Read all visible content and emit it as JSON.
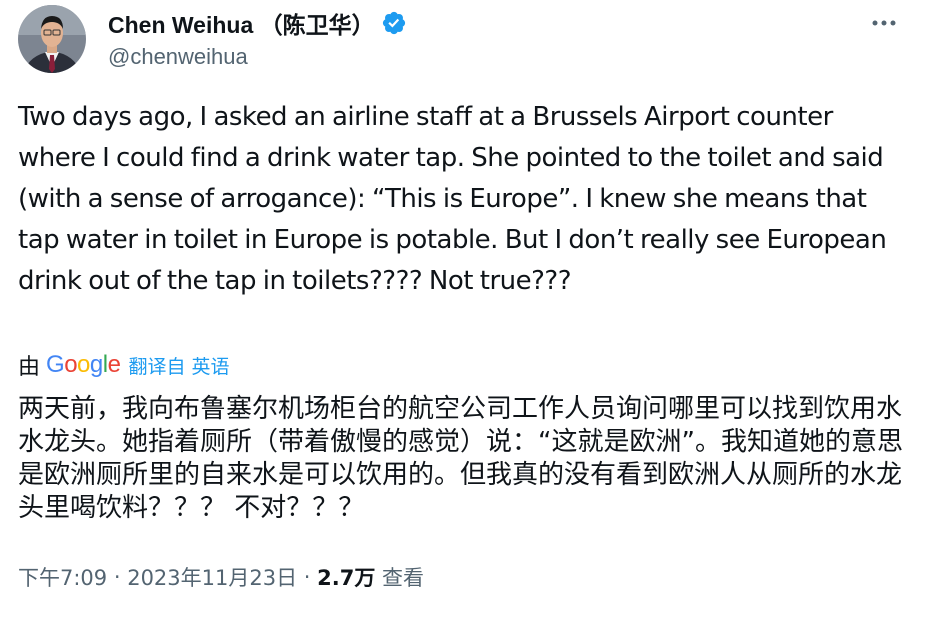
{
  "author": {
    "display_name": "Chen Weihua （陈卫华）",
    "handle": "@chenweihua",
    "verified": true,
    "avatar_icon": "profile-photo"
  },
  "more_icon": "more-horizontal-icon",
  "tweet": {
    "text_en": "Two days ago, I asked an airline staff at a Brussels Airport counter where I could find a drink water tap.  She pointed to the toilet and said (with a sense of arrogance): “This is Europe”. I knew she means that tap water in toilet in Europe is potable. But I don’t really see European drink out of the tap in toilets???? Not true???",
    "translation": {
      "by_label": "由",
      "provider": "Google",
      "from_label": "翻译自 英语"
    },
    "text_zh": "两天前，我向布鲁塞尔机场柜台的航空公司工作人员询问哪里可以找到饮用水水龙头。她指着厕所（带着傲慢的感觉）说：“这就是欧洲”。我知道她的意思是欧洲厕所里的自来水是可以饮用的。但我真的没有看到欧洲人从厕所的水龙头里喝饮料？？？ 不对？？？"
  },
  "meta": {
    "time": "下午7:09",
    "separator": " · ",
    "date": "2023年11月23日",
    "views_count": "2.7万",
    "views_label": " 查看"
  },
  "colors": {
    "text": "#0f1419",
    "secondary": "#536471",
    "link": "#1d9bf0",
    "verified_badge": "#1d9bf0"
  }
}
